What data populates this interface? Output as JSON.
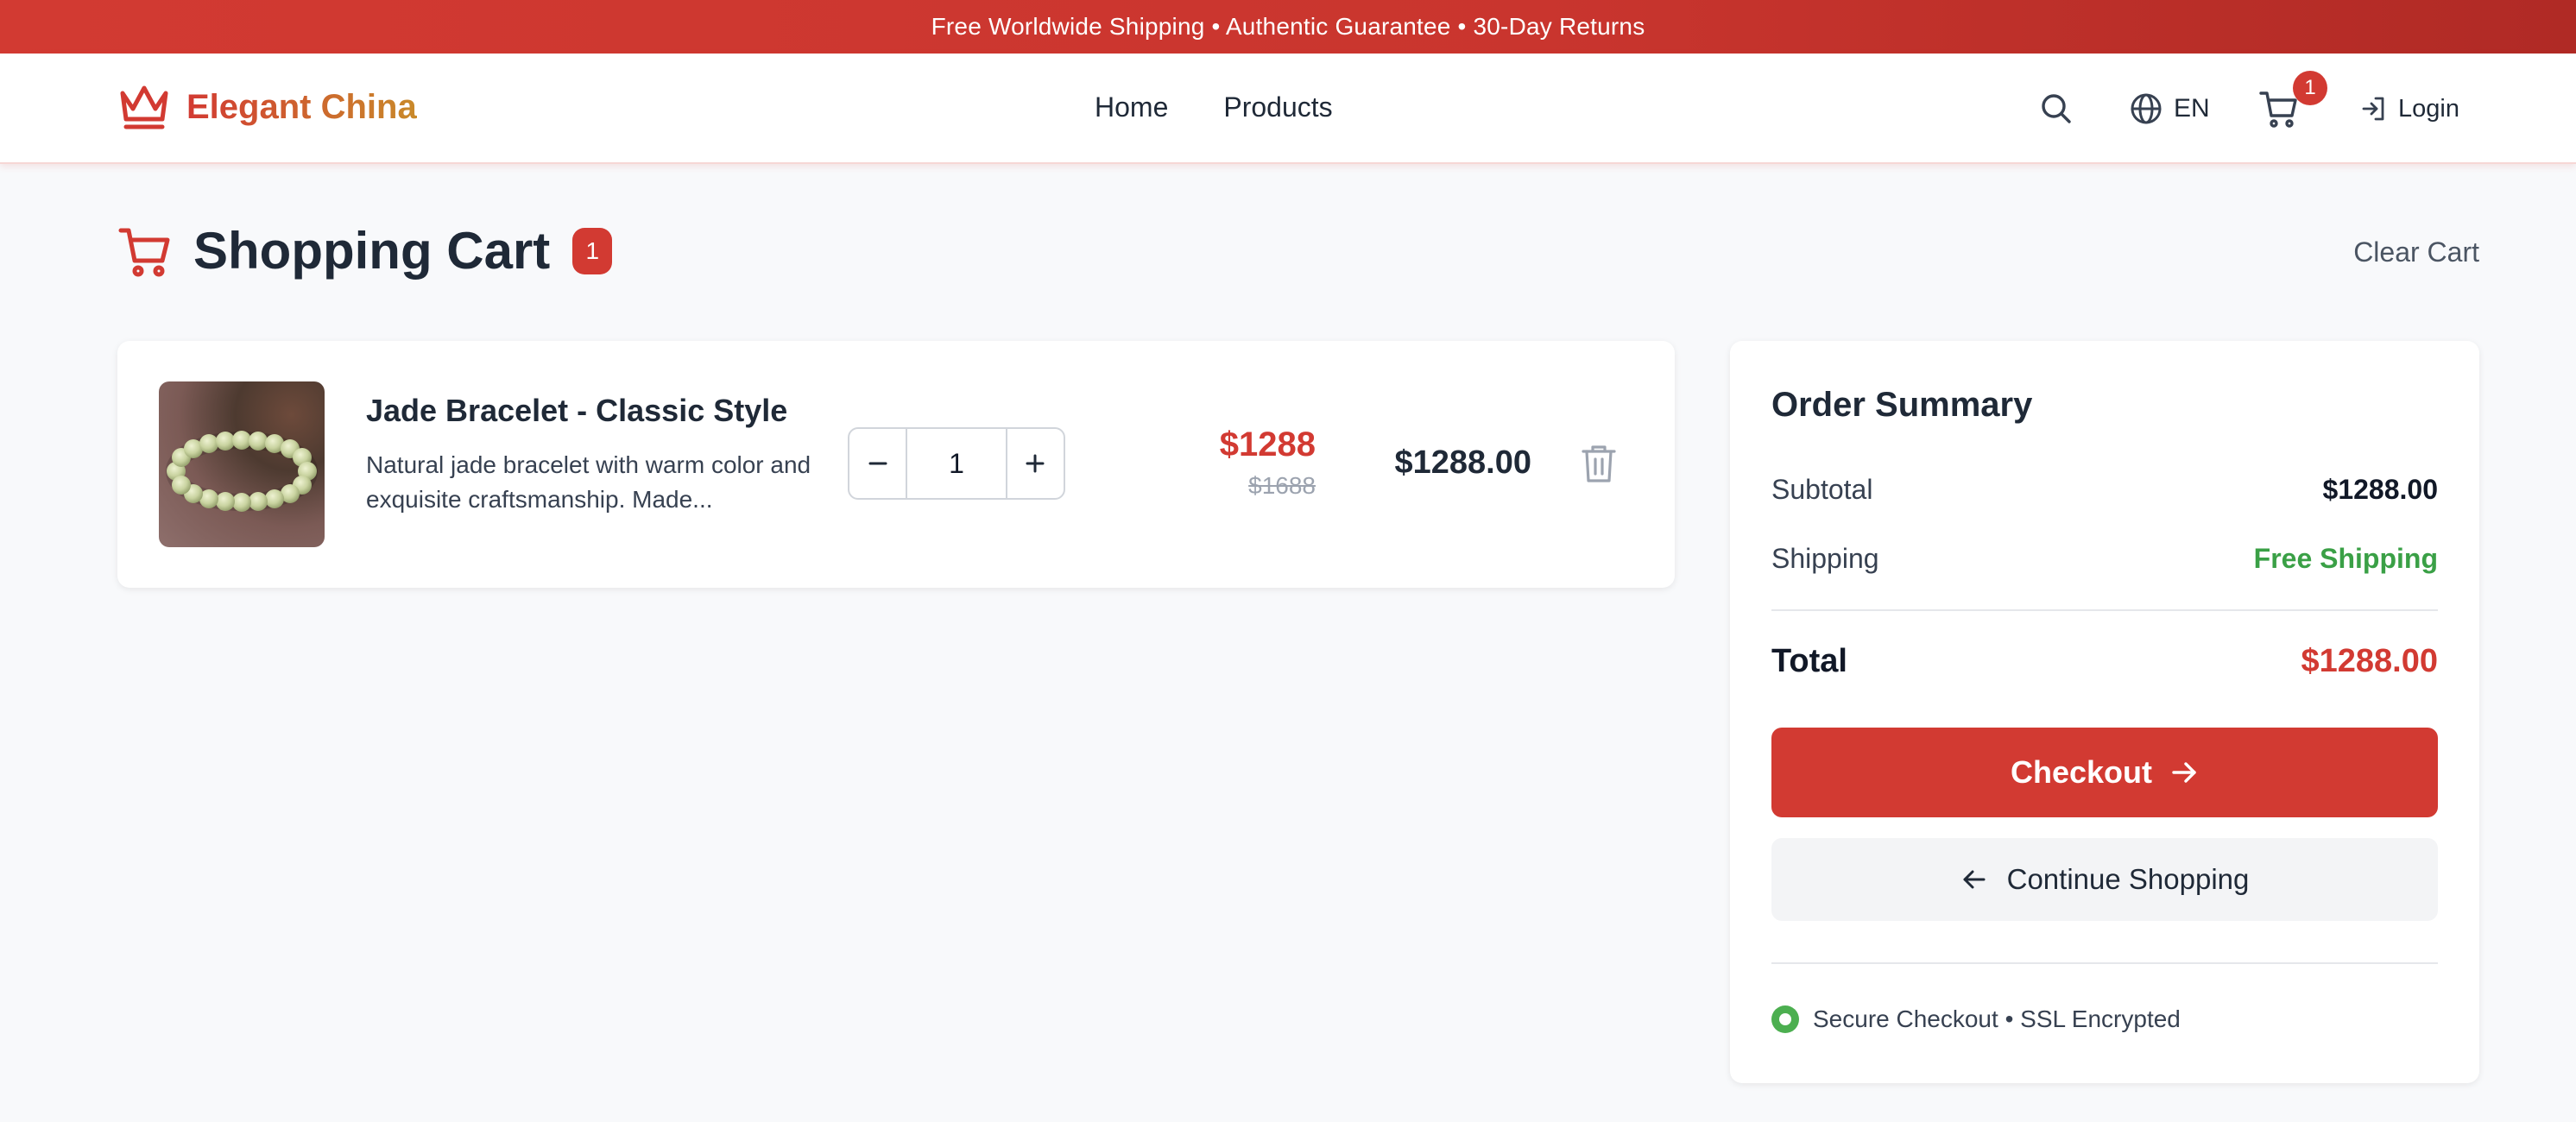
{
  "banner": {
    "text": "Free Worldwide Shipping • Authentic Guarantee • 30-Day Returns"
  },
  "header": {
    "brand": "Elegant China",
    "nav": [
      {
        "label": "Home"
      },
      {
        "label": "Products"
      }
    ],
    "language": "EN",
    "cart_count": "1",
    "login": "Login",
    "icons": [
      "crown-icon",
      "search-icon",
      "globe-icon",
      "cart-icon",
      "login-icon"
    ]
  },
  "page": {
    "title": "Shopping Cart",
    "count": "1",
    "clear_label": "Clear Cart"
  },
  "cart": {
    "items": [
      {
        "name": "Jade Bracelet - Classic Style",
        "description": "Natural jade bracelet with warm color and exquisite craftsmanship. Made...",
        "quantity": "1",
        "price": "$1288",
        "original_price": "$1688",
        "line_total": "$1288.00"
      }
    ]
  },
  "summary": {
    "title": "Order Summary",
    "subtotal_label": "Subtotal",
    "subtotal": "$1288.00",
    "shipping_label": "Shipping",
    "shipping": "Free Shipping",
    "total_label": "Total",
    "total": "$1288.00",
    "checkout_label": "Checkout",
    "continue_label": "Continue Shopping",
    "secure_text": "Secure Checkout • SSL Encrypted"
  },
  "colors": {
    "accent": "#d23a32",
    "success": "#3aa046",
    "background": "#f8f9fb"
  }
}
